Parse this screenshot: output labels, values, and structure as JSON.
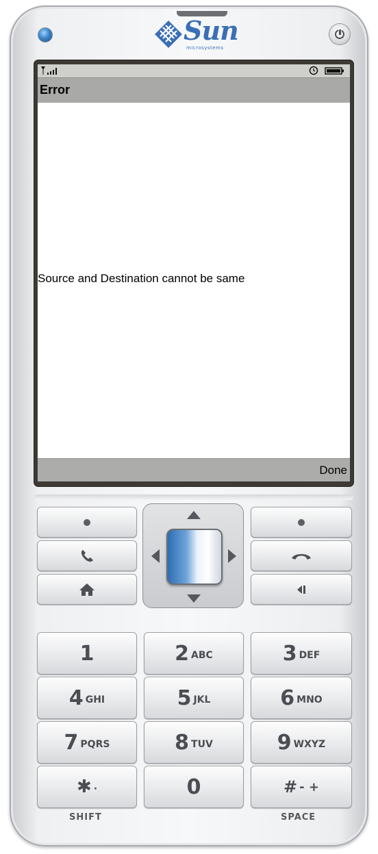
{
  "device": {
    "brand_text": "Sun",
    "brand_subtext": "microsystems"
  },
  "screen": {
    "title": "Error",
    "message": "Source and Destination cannot be same",
    "softkey_right": "Done"
  },
  "keypad": {
    "keys": [
      {
        "main": "1",
        "sub": ""
      },
      {
        "main": "2",
        "sub": "ABC"
      },
      {
        "main": "3",
        "sub": "DEF"
      },
      {
        "main": "4",
        "sub": "GHI"
      },
      {
        "main": "5",
        "sub": "JKL"
      },
      {
        "main": "6",
        "sub": "MNO"
      },
      {
        "main": "7",
        "sub": "PQRS"
      },
      {
        "main": "8",
        "sub": "TUV"
      },
      {
        "main": "9",
        "sub": "WXYZ"
      },
      {
        "main": "✱",
        "sub": "·"
      },
      {
        "main": "0",
        "sub": ""
      },
      {
        "main": "#",
        "sub": "- +"
      }
    ],
    "label_left": "SHIFT",
    "label_right": "SPACE"
  },
  "icons": {
    "left_soft": "soft-key-left-dot",
    "right_soft": "soft-key-right-dot",
    "call": "phone-call-icon",
    "end": "phone-hangup-icon",
    "home": "home-icon",
    "back": "backspace-icon"
  }
}
